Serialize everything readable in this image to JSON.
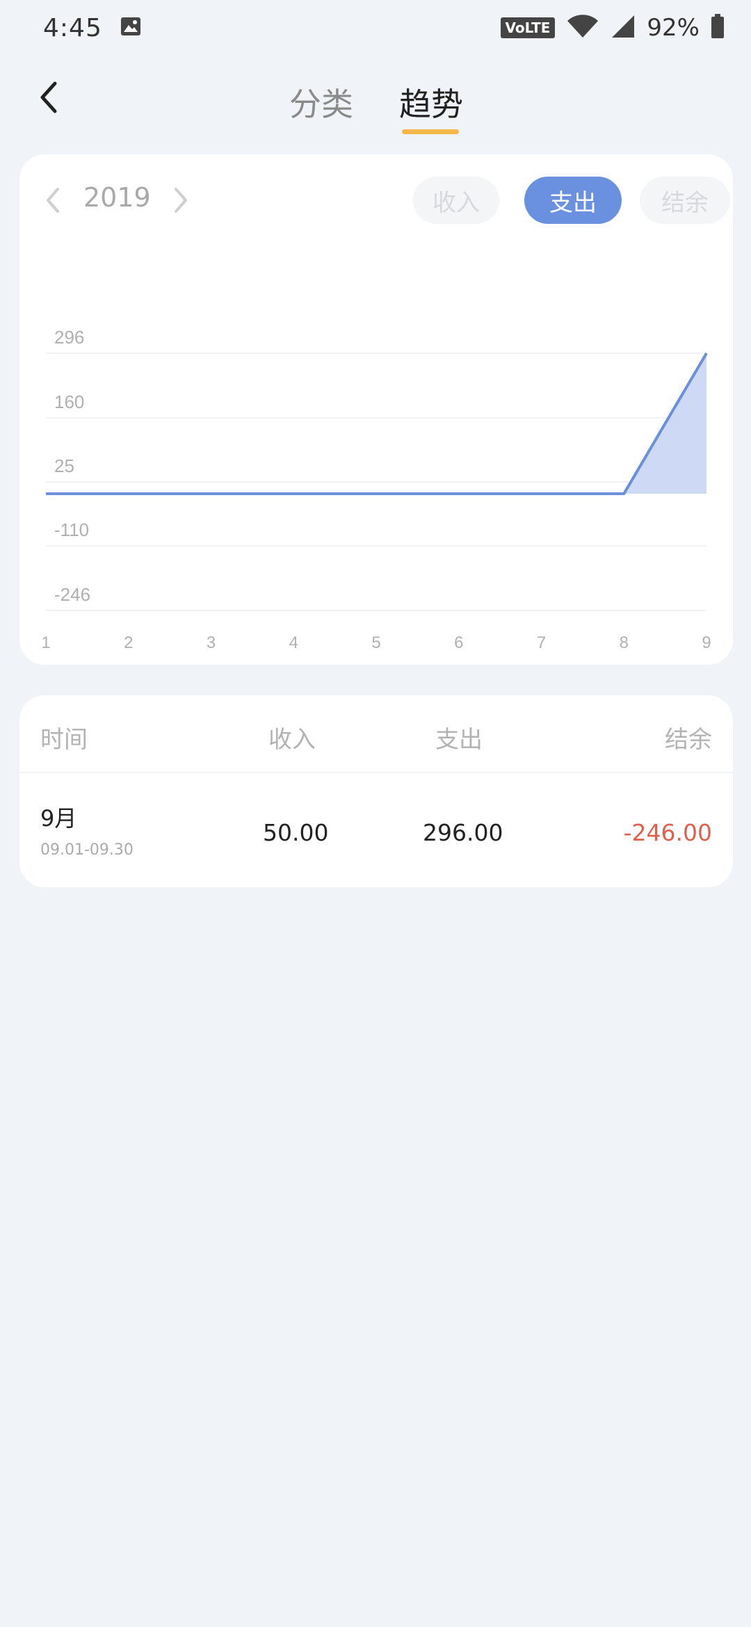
{
  "status_bar": {
    "time": "4:45",
    "network_badge": "VoLTE",
    "battery": "92%",
    "icons": [
      "image-icon",
      "wifi-icon",
      "signal-icon",
      "battery-icon"
    ]
  },
  "nav": {
    "back_icon": "chevron-left-icon",
    "tabs": [
      {
        "label": "分类",
        "active": false
      },
      {
        "label": "趋势",
        "active": true
      }
    ],
    "accent_color": "#f5b74a"
  },
  "chart_panel": {
    "year": "2019",
    "segments": [
      {
        "label": "收入",
        "active": false
      },
      {
        "label": "支出",
        "active": true
      },
      {
        "label": "结余",
        "active": false
      }
    ],
    "active_color": "#6a90e0"
  },
  "chart_data": {
    "type": "area",
    "x": [
      1,
      2,
      3,
      4,
      5,
      6,
      7,
      8,
      9
    ],
    "series": [
      {
        "values": [
          0,
          0,
          0,
          0,
          0,
          0,
          0,
          0,
          296
        ]
      }
    ],
    "y_ticks": [
      "296",
      "160",
      "25",
      "-110",
      "-246"
    ],
    "x_ticks": [
      "1",
      "2",
      "3",
      "4",
      "5",
      "6",
      "7",
      "8",
      "9"
    ],
    "ylim": [
      -246,
      296
    ],
    "grid": true,
    "line_color": "#6a8fdc",
    "fill_color": "#cdd9f5"
  },
  "table": {
    "headers": {
      "time": "时间",
      "income": "收入",
      "expense": "支出",
      "balance": "结余"
    },
    "rows": [
      {
        "month": "9月",
        "range": "09.01-09.30",
        "income": "50.00",
        "expense": "296.00",
        "balance": "-246.00"
      }
    ],
    "negative_color": "#e0604e"
  }
}
